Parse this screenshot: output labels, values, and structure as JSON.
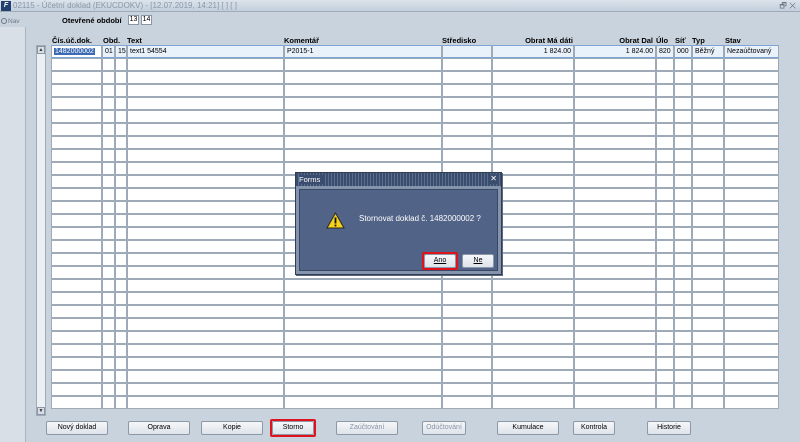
{
  "window": {
    "icon": "forms-icon",
    "title": "02115 - Účetní doklad (EKUCDOKV) - [12.07.2019, 14:21]  [ ]  [ ]",
    "controls": "🗗 ✕"
  },
  "nav": {
    "label": "Nav"
  },
  "period": {
    "label": "Otevřené období",
    "values": [
      "13",
      "14"
    ]
  },
  "columns": {
    "doc_no": "Čís.úč.dok.",
    "period": "Obd.",
    "text": "Text",
    "comment": "Komentář",
    "center": "Středisko",
    "md": "Obrat Má dáti",
    "dal": "Obrat Dal",
    "ulo": "Úlo",
    "sit": "Síť",
    "typ": "Typ",
    "stav": "Stav"
  },
  "rows": [
    {
      "doc_no": "1482000002",
      "period_a": "01",
      "period_b": "15",
      "text": "text1 54554",
      "comment": "P2015-1",
      "center": "",
      "md": "1 824.00",
      "dal": "1 824.00",
      "ulo": "820",
      "sit": "000",
      "typ": "Běžný",
      "stav": "Nezaúčtovaný"
    }
  ],
  "buttons": {
    "new": "Nový doklad",
    "edit": "Oprava",
    "copy": "Kopie",
    "storno": "Storno",
    "post": "Zaúčtování",
    "unpost": "Odúčtování",
    "cumulation": "Kumulace",
    "control": "Kontrola",
    "history": "Historie"
  },
  "dialog": {
    "title": "Forms",
    "close": "✕",
    "icon": "warning-icon",
    "message": "Stornovat doklad č. 1482000002 ?",
    "yes": "Ano",
    "no": "Ne"
  },
  "colors": {
    "highlight": "#e0121e",
    "dialog_bg": "#516387",
    "title_bar": "#3b4d6e"
  }
}
